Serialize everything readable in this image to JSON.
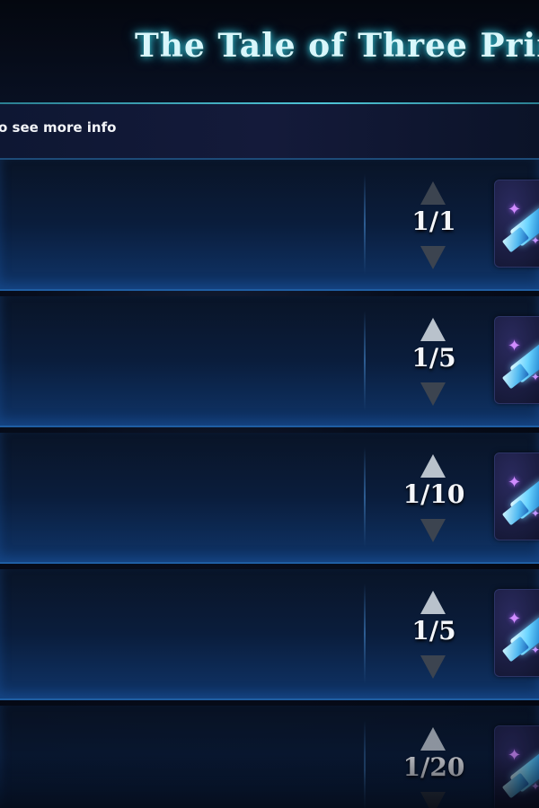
{
  "header": {
    "title": "The Tale of Three Prin"
  },
  "hint": {
    "text": "o see more info"
  },
  "rows": [
    {
      "count": "1/1",
      "item_icon": "blue-crystal-icon"
    },
    {
      "count": "1/5",
      "item_icon": "blue-crystal-icon"
    },
    {
      "count": "1/10",
      "item_icon": "blue-crystal-icon"
    },
    {
      "count": "1/5",
      "item_icon": "blue-crystal-icon"
    },
    {
      "count": "1/20",
      "item_icon": "blue-crystal-icon"
    }
  ],
  "colors": {
    "title_glow": "#36c7d8",
    "row_border": "#1f5ea3",
    "arrow_active": "#b9c2cc",
    "arrow_inactive": "#3c4450"
  }
}
